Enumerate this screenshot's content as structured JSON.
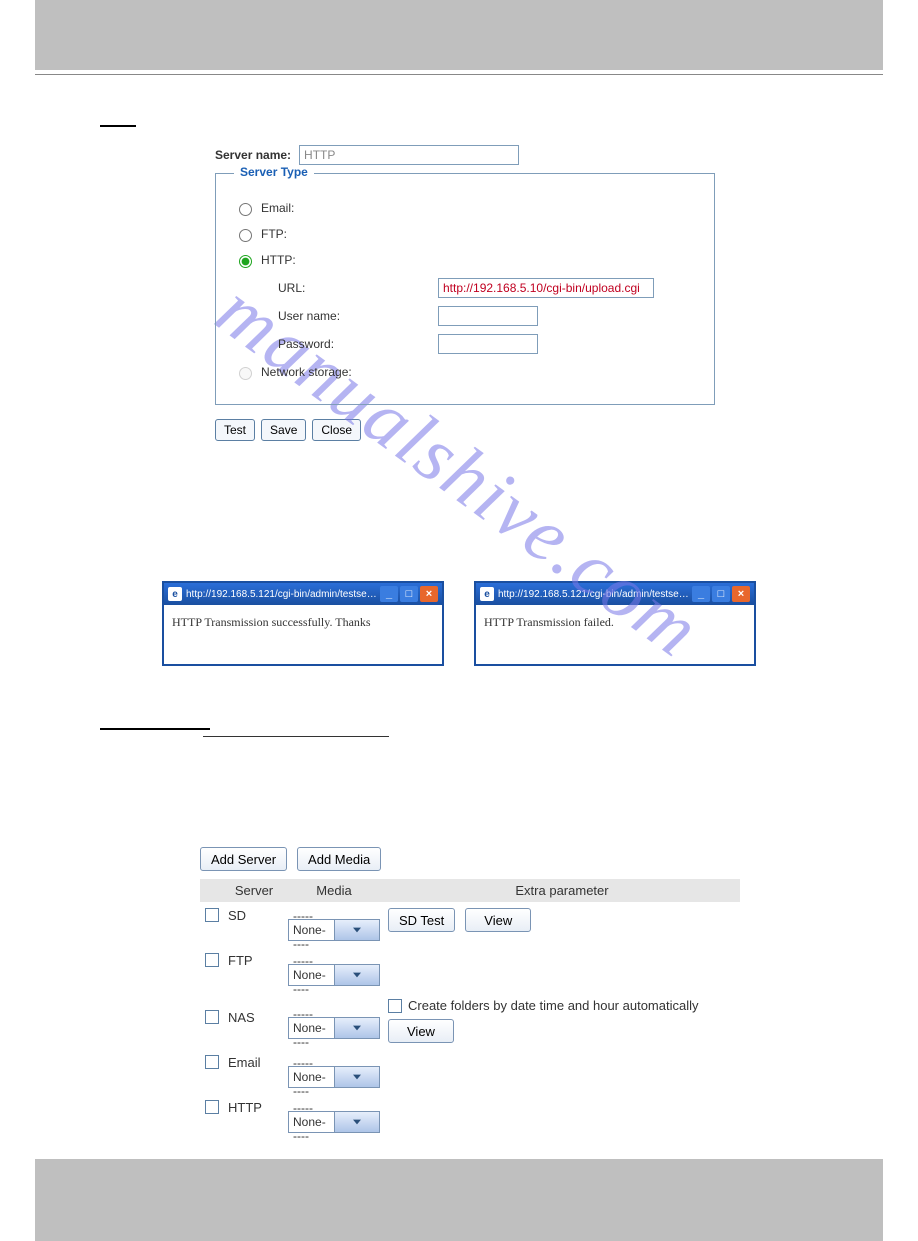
{
  "watermark": "manualshive.com",
  "form": {
    "server_name_label": "Server name:",
    "server_name_value": "HTTP",
    "legend": "Server Type",
    "options": {
      "email": "Email:",
      "ftp": "FTP:",
      "http": "HTTP:",
      "network_storage": "Network storage:"
    },
    "http": {
      "url_label": "URL:",
      "url_value": "http://192.168.5.10/cgi-bin/upload.cgi",
      "username_label": "User name:",
      "password_label": "Password:"
    },
    "buttons": {
      "test": "Test",
      "save": "Save",
      "close": "Close"
    }
  },
  "popups": {
    "title": "http://192.168.5.121/cgi-bin/admin/testserver.cgi - ...",
    "success": "HTTP Transmission successfully. Thanks",
    "failed": "HTTP Transmission failed."
  },
  "action": {
    "add_server": "Add Server",
    "add_media": "Add Media",
    "headers": {
      "server": "Server",
      "media": "Media",
      "extra": "Extra parameter"
    },
    "none_option": "-----None-----",
    "rows": {
      "sd": "SD",
      "ftp": "FTP",
      "nas": "NAS",
      "email": "Email",
      "http": "HTTP"
    },
    "extras": {
      "sd_test": "SD Test",
      "view": "View",
      "create_folders": "Create folders by date time and hour automatically"
    }
  }
}
